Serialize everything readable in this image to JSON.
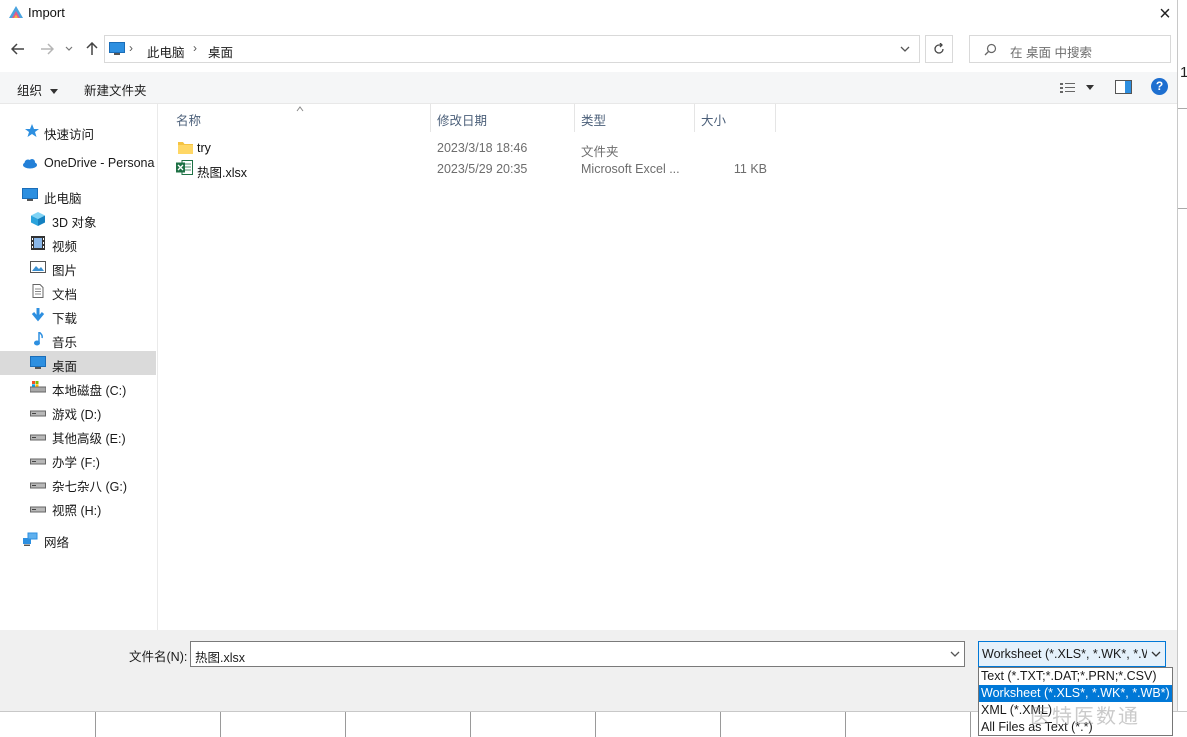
{
  "window": {
    "title": "Import",
    "close_icon": "×"
  },
  "address": {
    "crumbs": [
      "此电脑",
      "桌面"
    ]
  },
  "search": {
    "placeholder": "在 桌面 中搜索"
  },
  "toolbar": {
    "organize": "组织",
    "new_folder": "新建文件夹"
  },
  "nav": {
    "items": [
      {
        "label": "快速访问",
        "icon": "star-icon"
      },
      {
        "label": "OneDrive - Persona",
        "icon": "cloud-icon"
      },
      {
        "label": "此电脑",
        "icon": "computer-icon"
      },
      {
        "label": "3D 对象",
        "icon": "cube-icon"
      },
      {
        "label": "视频",
        "icon": "video-icon"
      },
      {
        "label": "图片",
        "icon": "picture-icon"
      },
      {
        "label": "文档",
        "icon": "document-icon"
      },
      {
        "label": "下载",
        "icon": "download-icon"
      },
      {
        "label": "音乐",
        "icon": "music-icon"
      },
      {
        "label": "桌面",
        "icon": "desktop-icon"
      },
      {
        "label": "本地磁盘 (C:)",
        "icon": "drive-icon"
      },
      {
        "label": "游戏 (D:)",
        "icon": "drive-icon"
      },
      {
        "label": "其他高级 (E:)",
        "icon": "drive-icon"
      },
      {
        "label": "办学 (F:)",
        "icon": "drive-icon"
      },
      {
        "label": "杂七杂八 (G:)",
        "icon": "drive-icon"
      },
      {
        "label": "视照 (H:)",
        "icon": "drive-icon"
      },
      {
        "label": "网络",
        "icon": "network-icon"
      }
    ]
  },
  "columns": {
    "name": "名称",
    "modified": "修改日期",
    "type": "类型",
    "size": "大小"
  },
  "files": [
    {
      "name": "try",
      "modified": "2023/3/18 18:46",
      "type": "文件夹",
      "size": "",
      "icon": "folder-icon"
    },
    {
      "name": "热图.xlsx",
      "modified": "2023/5/29 20:35",
      "type": "Microsoft Excel ...",
      "size": "11 KB",
      "icon": "excel-file-icon"
    }
  ],
  "bottom": {
    "filename_label": "文件名(N):",
    "filename_value": "热图.xlsx",
    "filter_selected": "Worksheet (*.XLS*, *.WK*, *.W",
    "filter_options": [
      "Text (*.TXT;*.DAT;*.PRN;*.CSV)",
      "Worksheet (*.XLS*, *.WK*, *.WB*)",
      "XML (*.XML)",
      "All Files as Text (*.*)"
    ]
  },
  "watermark": "医特医数通",
  "colors": {
    "accent": "#0078d7",
    "selection": "#dadada",
    "help": "#1e6fd0"
  }
}
